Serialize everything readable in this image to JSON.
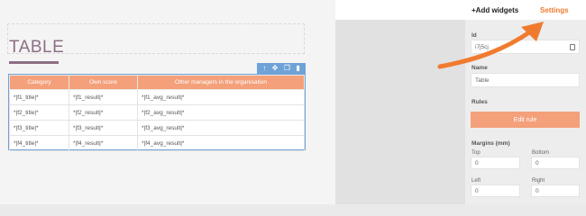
{
  "header": {
    "add_widgets": "+Add widgets",
    "settings": "Settings"
  },
  "canvas": {
    "title": "TABLE",
    "table": {
      "headers": [
        "Category",
        "Own score",
        "Other managers in the organisation"
      ],
      "rows": [
        [
          "*|f1_title|*",
          "*|f1_result|*",
          "*|f1_avg_result|*"
        ],
        [
          "*|f2_title|*",
          "*|f2_result|*",
          "*|f2_avg_result|*"
        ],
        [
          "*|f3_title|*",
          "*|f3_result|*",
          "*|f3_avg_result|*"
        ],
        [
          "*|f4_title|*",
          "*|f4_result|*",
          "*|f4_avg_result|*"
        ]
      ]
    },
    "toolbar_icons": [
      "arrow-up-icon",
      "move-icon",
      "copy-icon",
      "trash-icon"
    ]
  },
  "settings": {
    "id_label": "Id",
    "id_value": "i7j5cj",
    "name_label": "Name",
    "name_value": "Table",
    "rules_label": "Rules",
    "edit_rule": "Edit rule",
    "margins_label": "Margins (mm)",
    "top_label": "Top",
    "top_value": "0",
    "bottom_label": "Bottom",
    "bottom_value": "0",
    "left_label": "Left",
    "left_value": "0",
    "right_label": "Right",
    "right_value": "0"
  },
  "colors": {
    "accent": "#f4a07a",
    "settings_tab": "#f07b2f",
    "selection": "#6fa3d8",
    "title": "#8c6f83"
  }
}
